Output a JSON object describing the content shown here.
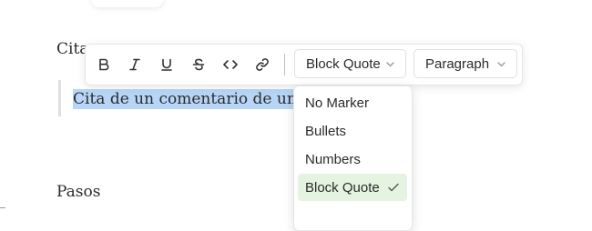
{
  "document": {
    "heading_partial": "Cita",
    "quote_text": "Cita de un comentario de un usu",
    "next_heading": "Pasos"
  },
  "toolbar": {
    "buttons": [
      {
        "name": "bold",
        "icon": "bold-icon"
      },
      {
        "name": "italic",
        "icon": "italic-icon"
      },
      {
        "name": "underline",
        "icon": "underline-icon"
      },
      {
        "name": "strikethrough",
        "icon": "strikethrough-icon"
      },
      {
        "name": "code",
        "icon": "code-icon"
      },
      {
        "name": "link",
        "icon": "link-icon"
      }
    ],
    "list_type_dropdown": "Block Quote",
    "block_type_dropdown": "Paragraph"
  },
  "menu": {
    "items": [
      {
        "label": "No Marker"
      },
      {
        "label": "Bullets"
      },
      {
        "label": "Numbers"
      },
      {
        "label": "Block Quote",
        "selected": true
      }
    ]
  },
  "colors": {
    "selection_highlight": "#b7d6f7",
    "selected_item_bg": "#e4f4e0"
  }
}
